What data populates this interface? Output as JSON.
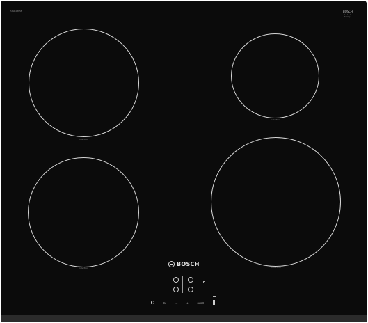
{
  "product": {
    "brand_name": "BOSCH",
    "model_code": "PUG611BB5E",
    "badge": {
      "line1": "BOSCH",
      "line2": "·····",
      "line3": "Serie | 4"
    }
  },
  "zones": {
    "front_left_tag": "Induction",
    "front_right_tag": "Induction",
    "rear_left_tag": "Induction",
    "rear_right_tag": "Induction"
  },
  "control_panel": {
    "touch_bar": {
      "minus_label": "0+",
      "slider_label": "—",
      "plus_label": "+",
      "timer_label": "auto 0"
    }
  },
  "colors": {
    "glass": "#0b0b0b",
    "zone_outline": "#d6d6d6",
    "edge": "#2b2b2b"
  }
}
